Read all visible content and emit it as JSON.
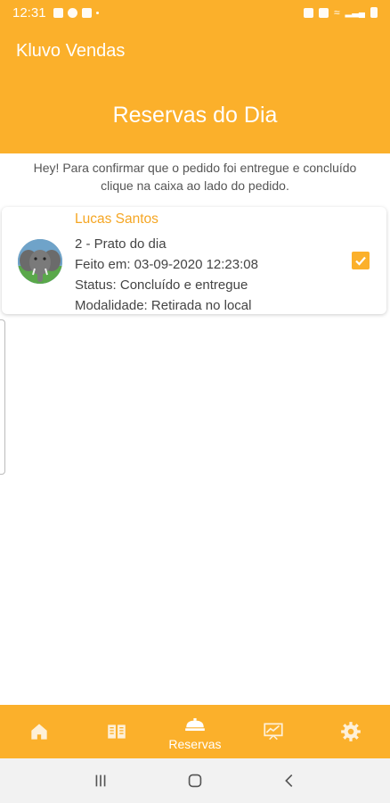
{
  "status_bar": {
    "time": "12:31"
  },
  "app": {
    "title": "Kluvo Vendas"
  },
  "page": {
    "title": "Reservas do Dia",
    "instruction_line1": "Hey! Para confirmar que o pedido foi entregue e concluído",
    "instruction_line2": "clique na caixa ao lado do pedido."
  },
  "orders": [
    {
      "customer": "Lucas Santos",
      "item": "2 - Prato do dia",
      "created": "Feito em: 03-09-2020 12:23:08",
      "status": "Status: Concluído e entregue",
      "mode": "Modalidade: Retirada no local",
      "checked": true
    }
  ],
  "bottom_nav": {
    "items": [
      {
        "icon": "home-icon",
        "label": ""
      },
      {
        "icon": "menu-book-icon",
        "label": ""
      },
      {
        "icon": "reservations-icon",
        "label": "Reservas",
        "active": true
      },
      {
        "icon": "chart-icon",
        "label": ""
      },
      {
        "icon": "gear-icon",
        "label": ""
      }
    ]
  },
  "colors": {
    "primary": "#fbb02b",
    "customer_name": "#f5a623",
    "text": "#444444"
  }
}
